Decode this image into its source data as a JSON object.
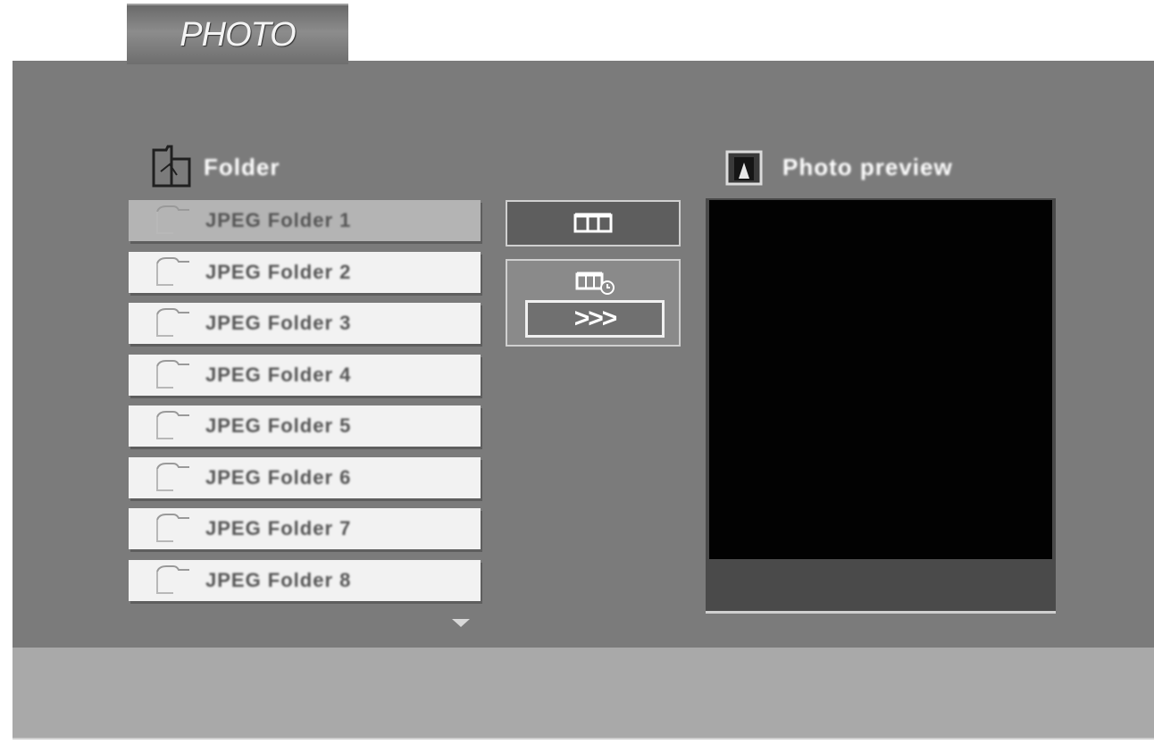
{
  "header": {
    "title": "PHOTO"
  },
  "folder_panel": {
    "icon": "folder-icon",
    "label": "Folder"
  },
  "preview_panel": {
    "icon": "photo-icon",
    "label": "Photo preview"
  },
  "files": [
    {
      "name": "JPEG Folder 1",
      "selected": true
    },
    {
      "name": "JPEG Folder 2",
      "selected": false
    },
    {
      "name": "JPEG Folder 3",
      "selected": false
    },
    {
      "name": "JPEG Folder 4",
      "selected": false
    },
    {
      "name": "JPEG Folder 5",
      "selected": false
    },
    {
      "name": "JPEG Folder 6",
      "selected": false
    },
    {
      "name": "JPEG Folder 7",
      "selected": false
    },
    {
      "name": "JPEG Folder 8",
      "selected": false
    }
  ],
  "controls": {
    "single_view_icon": "single-view-icon",
    "slideshow_icon": "slideshow-icon",
    "speed_label": ">>>"
  },
  "colors": {
    "screen_bg": "#7b7b7b",
    "list_item_bg": "#f2f2f2",
    "selected_item_bg": "#b4b4b4",
    "preview_bg": "#020202"
  }
}
